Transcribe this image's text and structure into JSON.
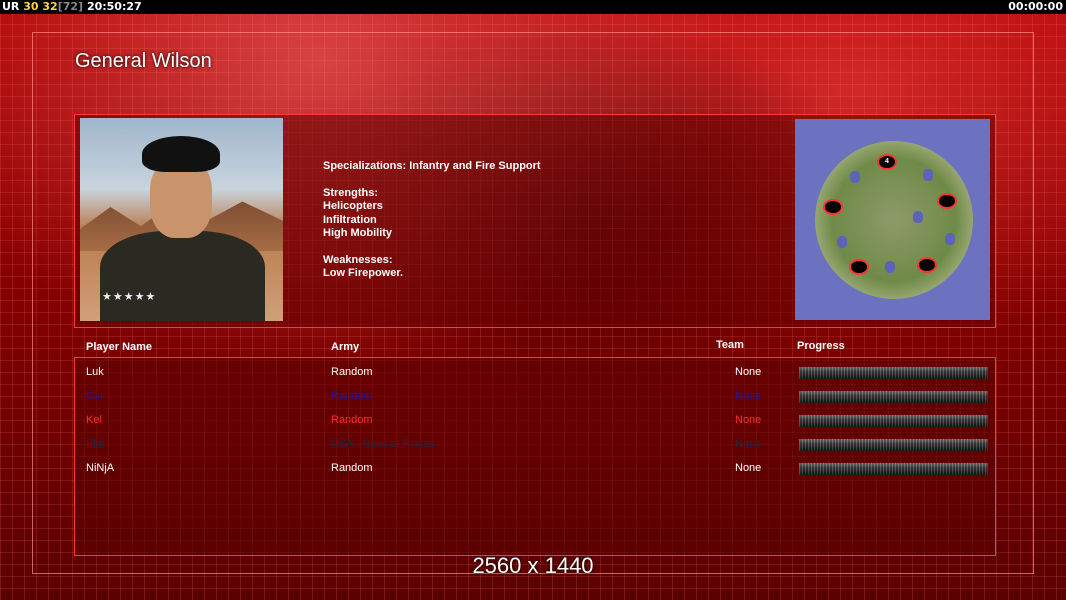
{
  "topbar": {
    "ur_label": "UR",
    "fps_a": "30",
    "fps_b": "32",
    "bracket_value": "[72]",
    "clock": "20:50:27",
    "game_time": "00:00:00"
  },
  "general": {
    "name": "General Wilson",
    "specializations": "Specializations: Infantry and Fire Support",
    "strengths_title": "Strengths:",
    "strengths": [
      "Helicopters",
      "Infiltration",
      "High Mobility"
    ],
    "weaknesses_title": "Weaknesses:",
    "weaknesses": [
      "Low Firepower."
    ]
  },
  "minimap": {
    "player_marker_label": "4"
  },
  "table": {
    "headers": {
      "player": "Player Name",
      "army": "Army",
      "team": "Team",
      "progress": "Progress"
    },
    "rows": [
      {
        "player": "Luk",
        "army": "Random",
        "team": "None",
        "color": "#ffffff",
        "progress": 0
      },
      {
        "player": "Cor",
        "army": "Random",
        "team": "None",
        "color": "#1a1aa0",
        "progress": 0
      },
      {
        "player": "Kel",
        "army": "Random",
        "team": "None",
        "color": "#ff2a2a",
        "progress": 0
      },
      {
        "player": "Phil",
        "army": "USA - Special Forces",
        "team": "None",
        "color": "#1e2a4a",
        "progress": 0
      },
      {
        "player": "NiNjA",
        "army": "Random",
        "team": "None",
        "color": "#ffffff",
        "progress": 0
      }
    ]
  },
  "footer": {
    "resolution": "2560 x 1440"
  }
}
